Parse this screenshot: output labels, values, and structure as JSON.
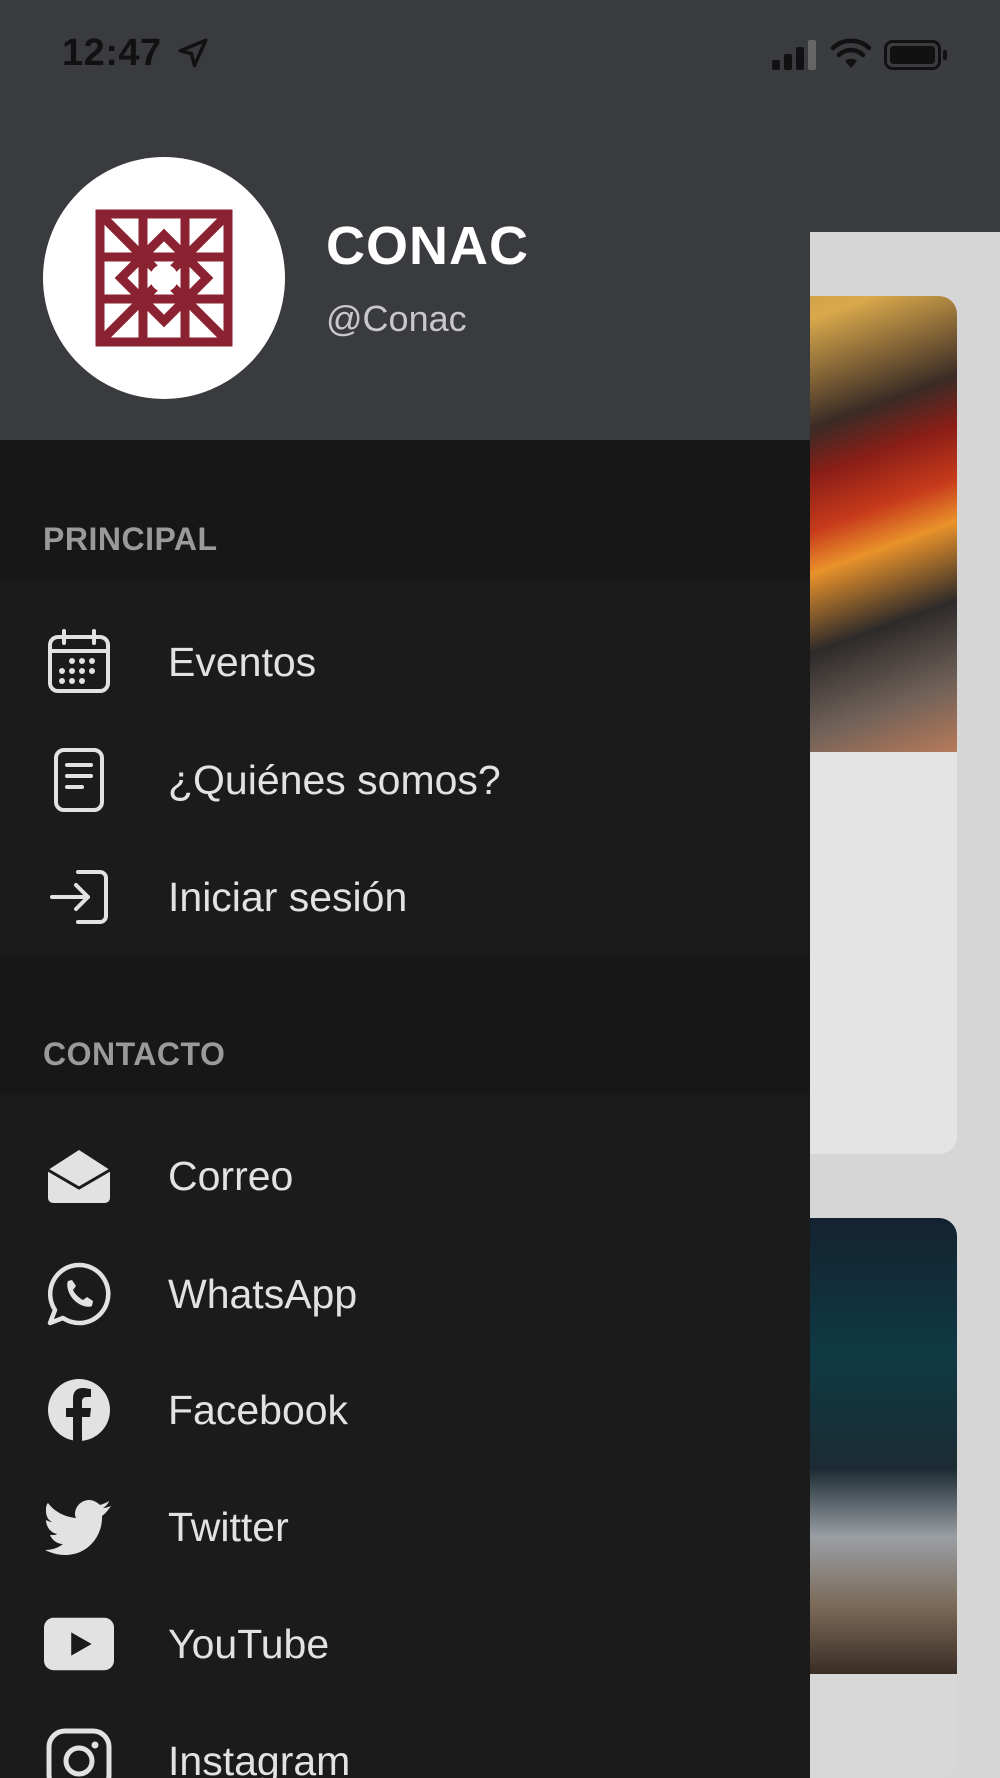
{
  "status_bar": {
    "time": "12:47"
  },
  "drawer": {
    "profile": {
      "name": "CONAC",
      "handle": "@Conac",
      "logo_color": "#8a2231"
    },
    "sections": [
      {
        "title": "PRINCIPAL",
        "items": [
          {
            "label": "Eventos",
            "icon": "calendar-icon"
          },
          {
            "label": "¿Quiénes somos?",
            "icon": "document-icon"
          },
          {
            "label": "Iniciar sesión",
            "icon": "login-icon"
          }
        ]
      },
      {
        "title": "CONTACTO",
        "items": [
          {
            "label": "Correo",
            "icon": "mail-icon"
          },
          {
            "label": "WhatsApp",
            "icon": "whatsapp-icon"
          },
          {
            "label": "Facebook",
            "icon": "facebook-icon"
          },
          {
            "label": "Twitter",
            "icon": "twitter-icon"
          },
          {
            "label": "YouTube",
            "icon": "youtube-icon"
          },
          {
            "label": "Instagram",
            "icon": "instagram-icon"
          }
        ]
      }
    ]
  },
  "colors": {
    "drawer_bg": "#1b1b1c",
    "drawer_header_bg": "#3a3b3f",
    "section_bg": "#171717",
    "label_text": "#e2e2e2",
    "section_text": "#9a9a9a"
  }
}
